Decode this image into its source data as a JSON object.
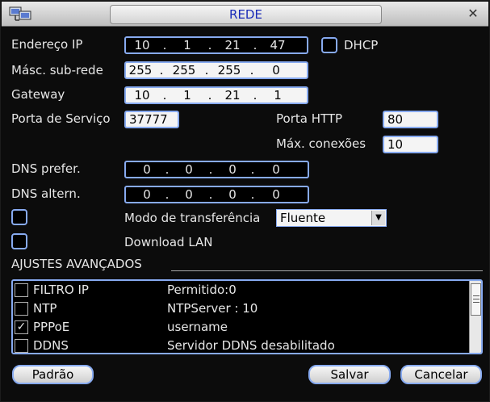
{
  "window": {
    "title": "REDE",
    "icon": "network-icon",
    "close_icon": "close-icon"
  },
  "labels": {
    "ip": "Endereço IP",
    "dhcp": "DHCP",
    "subnet": "Másc. sub-rede",
    "gateway": "Gateway",
    "service_port": "Porta de Serviço",
    "http_port": "Porta HTTP",
    "max_conn": "Máx. conexões",
    "dns_pref": "DNS prefer.",
    "dns_alt": "DNS altern.",
    "transfer_mode": "Modo de transferência",
    "download_lan": "Download LAN",
    "advanced_section": "AJUSTES AVANÇADOS"
  },
  "fields": {
    "ip": [
      "10",
      "1",
      "21",
      "47"
    ],
    "ip_separator": ".",
    "subnet": [
      "255",
      "255",
      "255",
      "0"
    ],
    "gateway": [
      "10",
      "1",
      "21",
      "1"
    ],
    "service_port": "37777",
    "http_port": "80",
    "max_conn": "10",
    "dns_pref": [
      "0",
      "0",
      "0",
      "0"
    ],
    "dns_alt": [
      "0",
      "0",
      "0",
      "0"
    ],
    "transfer_mode": "Fluente"
  },
  "checkboxes": {
    "dhcp": false,
    "transfer_mode": false,
    "download_lan": false
  },
  "advanced_items": [
    {
      "name": "FILTRO IP",
      "value": "Permitido:0",
      "checked": false
    },
    {
      "name": "NTP",
      "value": "NTPServer : 10",
      "checked": false
    },
    {
      "name": "PPPoE",
      "value": "username",
      "checked": true
    },
    {
      "name": "DDNS",
      "value": "Servidor DDNS desabilitado",
      "checked": false
    }
  ],
  "buttons": {
    "default": "Padrão",
    "save": "Salvar",
    "cancel": "Cancelar"
  },
  "colors": {
    "field_border": "#87aaf0",
    "title_text": "#1a2bb8",
    "background": "#0c0c0c"
  }
}
